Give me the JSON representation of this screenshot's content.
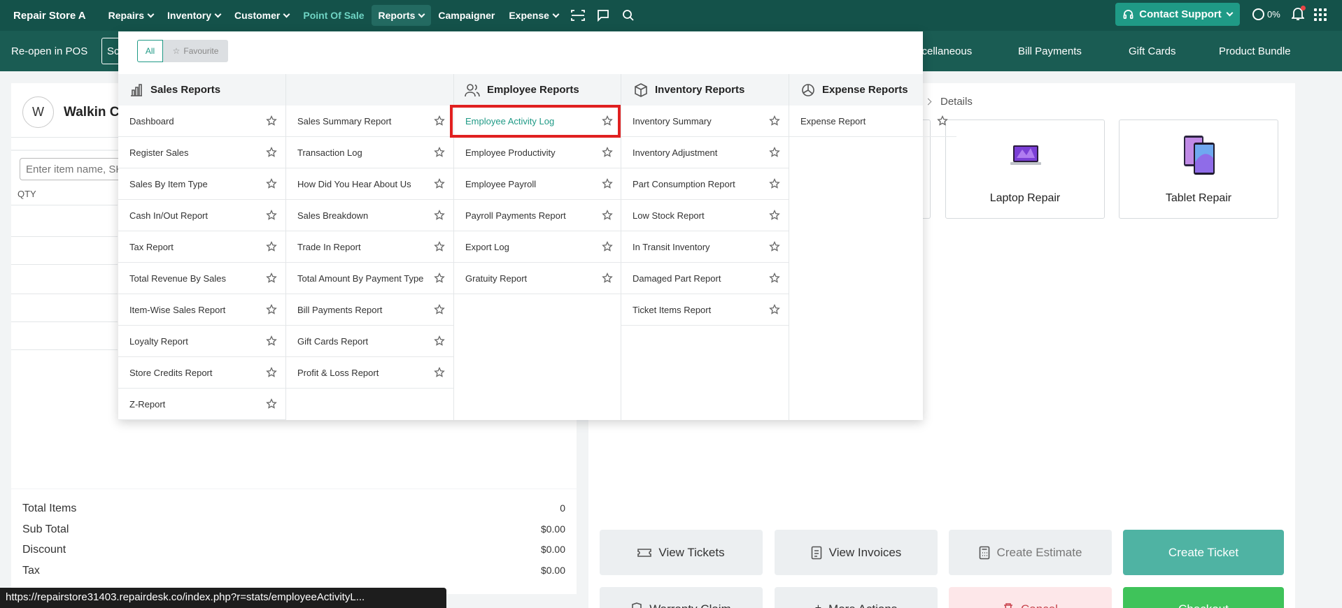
{
  "nav": {
    "brand": "Repair Store A",
    "items": [
      {
        "label": "Repairs",
        "has_menu": true
      },
      {
        "label": "Inventory",
        "has_menu": true
      },
      {
        "label": "Customer",
        "has_menu": true
      },
      {
        "label": "Point Of Sale",
        "has_menu": false
      },
      {
        "label": "Reports",
        "has_menu": true
      },
      {
        "label": "Campaigner",
        "has_menu": false
      },
      {
        "label": "Expense",
        "has_menu": true
      }
    ],
    "support_label": "Contact Support",
    "progress_text": "0%"
  },
  "subbar": {
    "reopen": "Re-open in POS",
    "sc": "Sc",
    "tabs": [
      "scellaneous",
      "Bill Payments",
      "Gift Cards",
      "Product Bundle"
    ]
  },
  "customer": {
    "initial": "W",
    "name": "Walkin C"
  },
  "cart": {
    "search_placeholder": "Enter item name, SK",
    "qty_label": "QTY"
  },
  "totals": {
    "rows": [
      {
        "label": "Total Items",
        "value": "0"
      },
      {
        "label": "Sub Total",
        "value": "$0.00"
      },
      {
        "label": "Discount",
        "value": "$0.00"
      },
      {
        "label": "Tax",
        "value": "$0.00"
      }
    ]
  },
  "right": {
    "crumb": "Details",
    "cards": [
      "Laptop Repair",
      "Tablet Repair"
    ],
    "buttons": [
      "View Tickets",
      "View Invoices",
      "Create Estimate",
      "Create Ticket"
    ],
    "bottom_buttons": [
      "Warranty Claim",
      "More Actions",
      "Cancel",
      "Checkout"
    ]
  },
  "dropdown": {
    "filter_all": "All",
    "filter_fav": "Favourite",
    "sections": [
      {
        "title": "Sales Reports",
        "icon": "bar-chart-icon"
      },
      {
        "title": "Employee Reports",
        "icon": "users-icon"
      },
      {
        "title": "Inventory Reports",
        "icon": "box-icon"
      },
      {
        "title": "Expense Reports",
        "icon": "pie-chart-icon"
      }
    ],
    "sales_col1": [
      "Dashboard",
      "Register Sales",
      "Sales By Item Type",
      "Cash In/Out Report",
      "Tax Report",
      "Total Revenue By Sales",
      "Item-Wise Sales Report",
      "Loyalty Report",
      "Store Credits Report",
      "Z-Report"
    ],
    "sales_col2": [
      "Sales Summary Report",
      "Transaction Log",
      "How Did You Hear About Us",
      "Sales Breakdown",
      "Trade In Report",
      "Total Amount By Payment Type",
      "Bill Payments Report",
      "Gift Cards Report",
      "Profit & Loss Report"
    ],
    "employee": [
      "Employee Activity Log",
      "Employee Productivity",
      "Employee Payroll",
      "Payroll Payments Report",
      "Export Log",
      "Gratuity Report"
    ],
    "inventory": [
      "Inventory Summary",
      "Inventory Adjustment",
      "Part Consumption Report",
      "Low Stock Report",
      "In Transit Inventory",
      "Damaged Part Report",
      "Ticket Items Report"
    ],
    "expense": [
      "Expense Report"
    ]
  },
  "status_url": "https://repairstore31403.repairdesk.co/index.php?r=stats/employeeActivityL..."
}
